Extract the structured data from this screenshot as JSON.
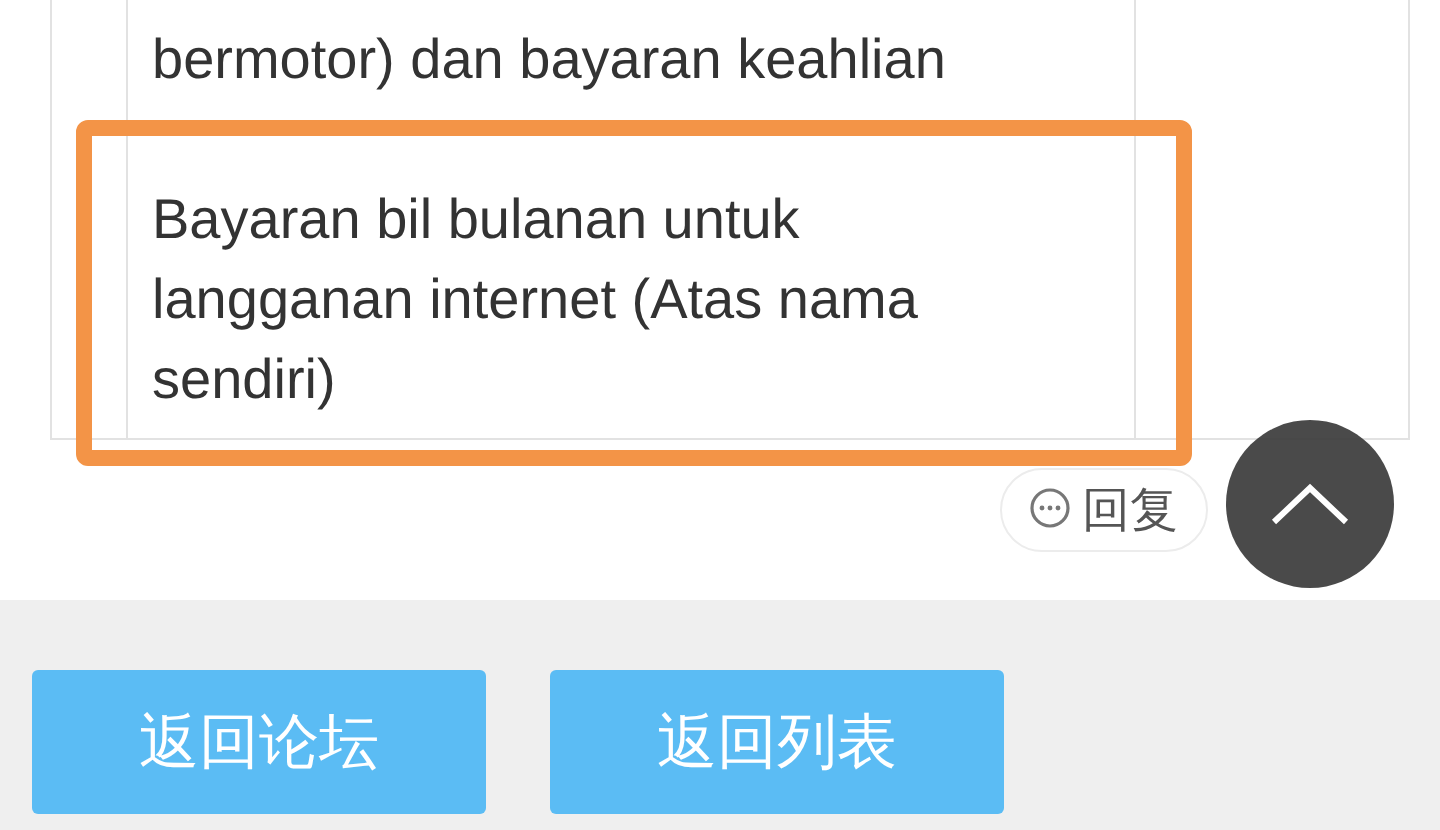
{
  "post_table": {
    "paragraphs": [
      "bermotor) dan bayaran keahlian",
      "Bayaran bil bulanan untuk\nlangganan internet (Atas nama\nsendiri)"
    ]
  },
  "reply_button": {
    "label": "回复"
  },
  "footer_buttons": [
    "返回论坛",
    "返回列表"
  ]
}
